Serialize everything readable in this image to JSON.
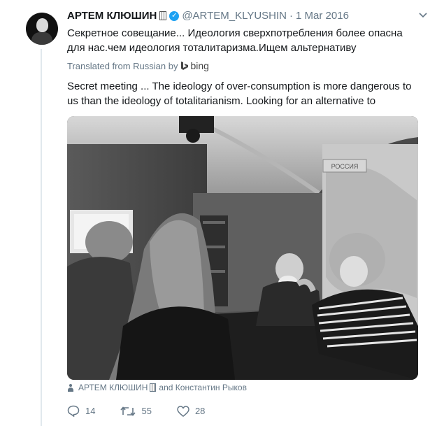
{
  "tweet": {
    "author_name": "АРТЕМ КЛЮШИН",
    "handle": "@ARTEM_KLYUSHIN",
    "separator": "·",
    "date": "1 Mar 2016",
    "text": "Секретное совещание... Идеология сверхпотребления более опасна для нас.чем идеология тоталитаризма.Ищем альтернативу",
    "translated_label": "Translated from Russian by",
    "translator": "bing",
    "translation": "Secret meeting ... The ideology of over-consumption is more dangerous to us than the ideology of totalitarianism. Looking for an alternative to",
    "photo_map_label": "РОССИЯ",
    "tagged": {
      "first": "АРТЕМ КЛЮШИН",
      "rest": " and Константин Рыков"
    },
    "actions": {
      "replies": "14",
      "retweets": "55",
      "likes": "28"
    }
  },
  "icons": {
    "verified": "verified-badge-icon",
    "building": "building-icon",
    "chevron": "chevron-down-icon",
    "reply": "reply-icon",
    "retweet": "retweet-icon",
    "like": "heart-icon",
    "tag": "person-tag-icon",
    "bing": "bing-logo-icon"
  },
  "colors": {
    "accent": "#1da1f2",
    "muted": "#657786",
    "text": "#14171a"
  }
}
